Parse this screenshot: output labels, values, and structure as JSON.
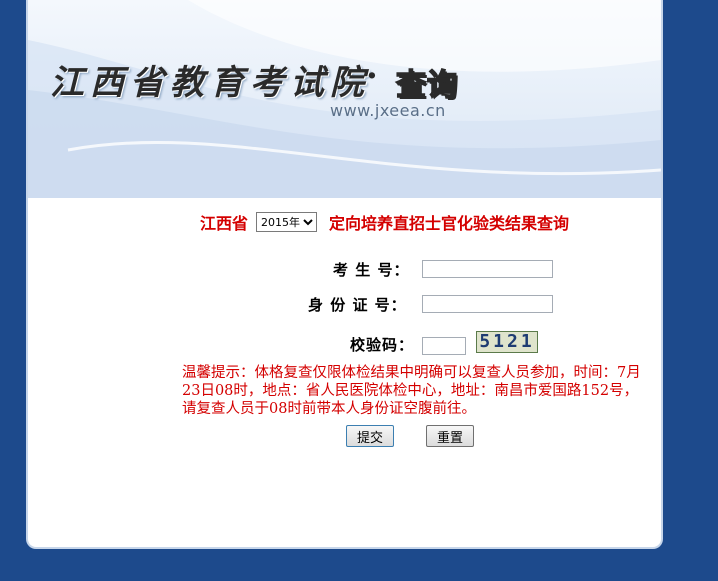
{
  "banner": {
    "site_name": "江西省教育考试院",
    "separator": "·",
    "query_word": "查询",
    "url": "www.jxeea.cn"
  },
  "heading": {
    "province": "江西省",
    "year_selected": "2015年",
    "title": "定向培养直招士官化验类结果查询"
  },
  "form": {
    "exam_no_label": "考 生 号：",
    "id_no_label": "身 份 证 号：",
    "captcha_label": "校验码：",
    "exam_no_value": "",
    "id_no_value": "",
    "captcha_value": "",
    "captcha_image_text": "5121"
  },
  "notice": "温馨提示：体格复查仅限体检结果中明确可以复查人员参加，时间：7月23日08时，地点：省人民医院体检中心，地址：南昌市爱国路152号，请复查人员于08时前带本人身份证空腹前往。",
  "buttons": {
    "submit": "提交",
    "reset": "重置"
  },
  "colors": {
    "background": "#1d4a8c",
    "accent_red": "#d40000"
  }
}
